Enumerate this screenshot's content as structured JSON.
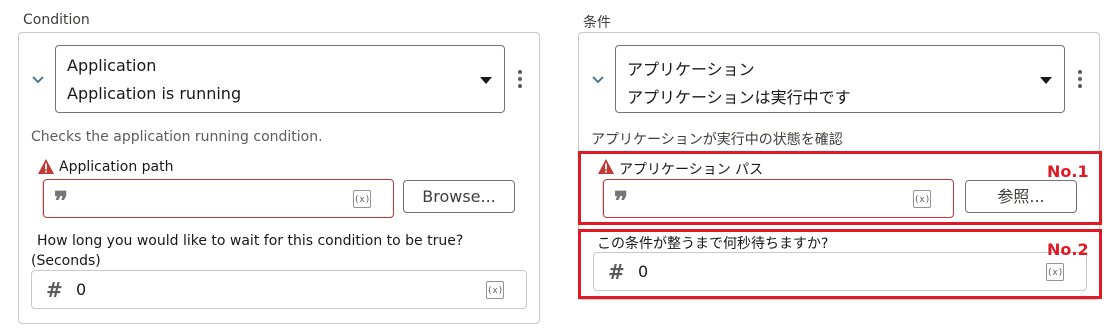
{
  "english": {
    "section_title": "Condition",
    "select_title": "Application",
    "select_value": "Application is running",
    "description": "Checks the application running condition.",
    "path_label": "Application path",
    "path_value": "",
    "browse_button": "Browse...",
    "wait_label_line1": "How long you would like to wait for this condition to be true?",
    "wait_label_line2": "(Seconds)",
    "wait_value": "0",
    "fx_badge": "(x)"
  },
  "japanese": {
    "section_title": "条件",
    "select_title": "アプリケーション",
    "select_value": "アプリケーションは実行中です",
    "description": "アプリケーションが実行中の状態を確認",
    "path_label": "アプリケーション パス",
    "path_value": "",
    "browse_button": "参照...",
    "wait_label": "この条件が整うまで何秒待ちますか?",
    "wait_value": "0",
    "fx_badge": "(x)"
  },
  "annotations": {
    "tag1": "No.1",
    "tag2": "No.2",
    "color": "#e01a24"
  },
  "icons": {
    "chevron": "chevron-down-icon",
    "caret": "caret-down-icon",
    "kebab": "more-vertical-icon",
    "warning": "warning-icon",
    "quote": "text-quote-icon",
    "hash": "number-hash-icon",
    "variable": "variable-fx-icon"
  }
}
